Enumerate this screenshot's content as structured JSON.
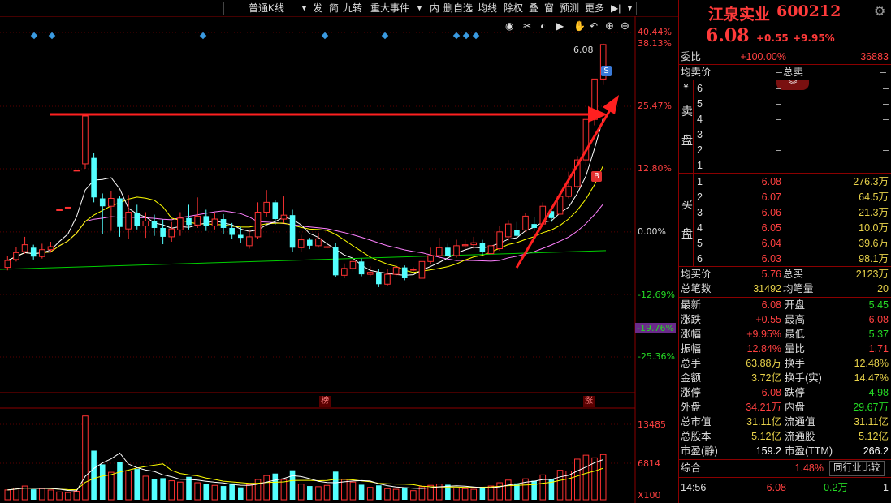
{
  "toolbar": {
    "period": "普通K线",
    "items": [
      "发",
      "简",
      "九转",
      "重大事件",
      "内",
      "删自选",
      "均线",
      "除权",
      "叠",
      "窗",
      "预测",
      "更多"
    ]
  },
  "axis": {
    "pct_labels": [
      "40.44%",
      "38.13%",
      "25.47%",
      "12.80%",
      "0.00%",
      "-12.69%",
      "-19.76%",
      "-25.36%"
    ],
    "vol_labels": [
      "13485",
      "6814",
      "X100"
    ],
    "price_marker": "6.08",
    "markers": {
      "bang": "榜",
      "zhang": "涨",
      "s": "S",
      "b": "B"
    }
  },
  "stock": {
    "name": "江泉实业",
    "code": "600212",
    "price": "6.08",
    "change": "+0.55",
    "pct": "+9.95%"
  },
  "weibi": {
    "label": "委比",
    "pct": "+100.00%",
    "value": "36883"
  },
  "sell_header": {
    "label": "均卖价",
    "value": "–",
    "label2": "总卖",
    "value2": "–"
  },
  "sell_side": {
    "title": "卖盘",
    "prefix": "¥",
    "levels": [
      {
        "n": "6",
        "p": "–",
        "v": "–"
      },
      {
        "n": "5",
        "p": "–",
        "v": "–"
      },
      {
        "n": "4",
        "p": "–",
        "v": "–"
      },
      {
        "n": "3",
        "p": "–",
        "v": "–"
      },
      {
        "n": "2",
        "p": "–",
        "v": "–"
      },
      {
        "n": "1",
        "p": "–",
        "v": "–"
      }
    ]
  },
  "buy_side": {
    "title": "买盘",
    "levels": [
      {
        "n": "1",
        "p": "6.08",
        "v": "276.3万"
      },
      {
        "n": "2",
        "p": "6.07",
        "v": "64.5万"
      },
      {
        "n": "3",
        "p": "6.06",
        "v": "21.3万"
      },
      {
        "n": "4",
        "p": "6.05",
        "v": "10.0万"
      },
      {
        "n": "5",
        "p": "6.04",
        "v": "39.6万"
      },
      {
        "n": "6",
        "p": "6.03",
        "v": "98.1万"
      }
    ]
  },
  "avg_buy": {
    "label": "均买价",
    "value": "5.76",
    "label2": "总买",
    "value2": "2123万"
  },
  "trade_count": {
    "label": "总笔数",
    "value": "31492",
    "label2": "均笔量",
    "value2": "20"
  },
  "stats": [
    {
      "l1": "最新",
      "v1": "6.08",
      "c1": "red",
      "l2": "开盘",
      "v2": "5.45",
      "c2": "green"
    },
    {
      "l1": "涨跌",
      "v1": "+0.55",
      "c1": "red",
      "l2": "最高",
      "v2": "6.08",
      "c2": "red"
    },
    {
      "l1": "涨幅",
      "v1": "+9.95%",
      "c1": "red",
      "l2": "最低",
      "v2": "5.37",
      "c2": "green"
    },
    {
      "l1": "振幅",
      "v1": "12.84%",
      "c1": "red",
      "l2": "量比",
      "v2": "1.71",
      "c2": "red"
    },
    {
      "l1": "总手",
      "v1": "63.88万",
      "c1": "yellow",
      "l2": "换手",
      "v2": "12.48%",
      "c2": "yellow"
    },
    {
      "l1": "金额",
      "v1": "3.72亿",
      "c1": "yellow",
      "l2": "换手(实)",
      "v2": "14.47%",
      "c2": "yellow"
    },
    {
      "l1": "涨停",
      "v1": "6.08",
      "c1": "red",
      "l2": "跌停",
      "v2": "4.98",
      "c2": "green"
    },
    {
      "l1": "外盘",
      "v1": "34.21万",
      "c1": "red",
      "l2": "内盘",
      "v2": "29.67万",
      "c2": "green"
    },
    {
      "l1": "总市值",
      "v1": "31.11亿",
      "c1": "yellow",
      "l2": "流通值",
      "v2": "31.11亿",
      "c2": "yellow"
    },
    {
      "l1": "总股本",
      "v1": "5.12亿",
      "c1": "yellow",
      "l2": "流通股",
      "v2": "5.12亿",
      "c2": "yellow"
    },
    {
      "l1": "市盈(静)",
      "v1": "159.2",
      "c1": "white",
      "l2": "市盈(TTM)",
      "v2": "266.2",
      "c2": "white"
    }
  ],
  "composite": {
    "label": "综合",
    "pct": "1.48%",
    "compare_btn": "同行业比较"
  },
  "tick": {
    "time": "14:56",
    "price": "6.08",
    "vol": "0.2万",
    "n": "1"
  },
  "colors": {
    "up": "#ff3232",
    "down": "#54ffff",
    "ma5": "#ffffff",
    "ma10": "#ffff00",
    "ma20": "#ff80ff",
    "ma60": "#00d000",
    "border": "#8b0000"
  },
  "chart_data": {
    "type": "candlestick",
    "pct_axis": {
      "top": 40.44,
      "bottom": -25.36
    },
    "volume_axis_labels": [
      13485,
      6814
    ],
    "candles": [
      {
        "o": -7.2,
        "c": -5.8,
        "h": -4.8,
        "l": -7.8,
        "v": 1500
      },
      {
        "o": -5.6,
        "c": -4.2,
        "h": -3.0,
        "l": -6.0,
        "v": 1800
      },
      {
        "o": -4.0,
        "c": -2.6,
        "h": -1.0,
        "l": -4.4,
        "v": 2100
      },
      {
        "o": -3.2,
        "c": -5.0,
        "h": -2.6,
        "l": -5.6,
        "v": 1600
      },
      {
        "o": -5.0,
        "c": -3.6,
        "h": -2.4,
        "l": -5.4,
        "v": 1700
      },
      {
        "o": -3.6,
        "c": -3.0,
        "h": -2.0,
        "l": -4.2,
        "v": 1500
      },
      {
        "o": 4.5,
        "c": 4.5,
        "h": 4.5,
        "l": 4.5,
        "v": 1200
      },
      {
        "o": 5.0,
        "c": 5.0,
        "h": 5.0,
        "l": 5.0,
        "v": 1100
      },
      {
        "o": 12.5,
        "c": 12.5,
        "h": 12.5,
        "l": 12.5,
        "v": 1300
      },
      {
        "o": 13.8,
        "c": 23.5,
        "h": 23.5,
        "l": 12.8,
        "v": 12800
      },
      {
        "o": 15.0,
        "c": 7.0,
        "h": 16.0,
        "l": 6.0,
        "v": 7500
      },
      {
        "o": 6.8,
        "c": 5.2,
        "h": 7.8,
        "l": -0.5,
        "v": 5400
      },
      {
        "o": 5.2,
        "c": 6.8,
        "h": 8.2,
        "l": 0.2,
        "v": 4200
      },
      {
        "o": 6.8,
        "c": 1.0,
        "h": 7.2,
        "l": -1.0,
        "v": 5800
      },
      {
        "o": 0.6,
        "c": 4.0,
        "h": 7.5,
        "l": -1.5,
        "v": 4400
      },
      {
        "o": 3.8,
        "c": 1.2,
        "h": 5.5,
        "l": 0.5,
        "v": 4700
      },
      {
        "o": 1.2,
        "c": 2.2,
        "h": 4.0,
        "l": -1.2,
        "v": 3600
      },
      {
        "o": 2.2,
        "c": 0.8,
        "h": 3.5,
        "l": -0.8,
        "v": 3100
      },
      {
        "o": 0.8,
        "c": -1.0,
        "h": 2.5,
        "l": -2.5,
        "v": 3300
      },
      {
        "o": -1.0,
        "c": 0.6,
        "h": 2.0,
        "l": -2.0,
        "v": 2900
      },
      {
        "o": 0.4,
        "c": 2.8,
        "h": 4.0,
        "l": -0.8,
        "v": 2700
      },
      {
        "o": 2.8,
        "c": 1.4,
        "h": 5.5,
        "l": 0.5,
        "v": 3500
      },
      {
        "o": 1.4,
        "c": 3.2,
        "h": 7.0,
        "l": 0.8,
        "v": 2600
      },
      {
        "o": 3.2,
        "c": 1.2,
        "h": 4.5,
        "l": 0.2,
        "v": 2400
      },
      {
        "o": 1.2,
        "c": 2.6,
        "h": 3.8,
        "l": 0.5,
        "v": 2200
      },
      {
        "o": 2.6,
        "c": 0.8,
        "h": 3.6,
        "l": -0.5,
        "v": 2100
      },
      {
        "o": 0.8,
        "c": -0.6,
        "h": 1.8,
        "l": -1.5,
        "v": 2500
      },
      {
        "o": -0.6,
        "c": -1.2,
        "h": 1.0,
        "l": -2.2,
        "v": 1900
      },
      {
        "o": -2.8,
        "c": -1.0,
        "h": 0.5,
        "l": -3.4,
        "v": 2300
      },
      {
        "o": -1.0,
        "c": 4.0,
        "h": 6.0,
        "l": -1.5,
        "v": 3100
      },
      {
        "o": 4.0,
        "c": 6.0,
        "h": 8.5,
        "l": 3.0,
        "v": 3700
      },
      {
        "o": 6.0,
        "c": 2.6,
        "h": 6.5,
        "l": 1.5,
        "v": 4000
      },
      {
        "o": 2.6,
        "c": 3.4,
        "h": 7.2,
        "l": 1.8,
        "v": 3100
      },
      {
        "o": 3.4,
        "c": -3.2,
        "h": 4.5,
        "l": -4.0,
        "v": 4500
      },
      {
        "o": -3.2,
        "c": -1.6,
        "h": -0.6,
        "l": -4.0,
        "v": 2400
      },
      {
        "o": -1.6,
        "c": -2.8,
        "h": -1.2,
        "l": -3.5,
        "v": 2100
      },
      {
        "o": -2.8,
        "c": -1.4,
        "h": -0.2,
        "l": -3.2,
        "v": 2000
      },
      {
        "o": -3.0,
        "c": -3.0,
        "h": -2.6,
        "l": -3.4,
        "v": 2200
      },
      {
        "o": -3.0,
        "c": -8.8,
        "h": -2.2,
        "l": -9.2,
        "v": 4300
      },
      {
        "o": -8.8,
        "c": -7.4,
        "h": -6.4,
        "l": -9.4,
        "v": 3100
      },
      {
        "o": -7.4,
        "c": -6.0,
        "h": -5.0,
        "l": -8.0,
        "v": 2700
      },
      {
        "o": -6.0,
        "c": -8.6,
        "h": -5.4,
        "l": -9.0,
        "v": 2300
      },
      {
        "o": -8.6,
        "c": -8.2,
        "h": -7.0,
        "l": -9.0,
        "v": 1900
      },
      {
        "o": -8.2,
        "c": -10.6,
        "h": -7.6,
        "l": -11.2,
        "v": 2200
      },
      {
        "o": -10.6,
        "c": -8.6,
        "h": -7.6,
        "l": -11.0,
        "v": 1700
      },
      {
        "o": -8.6,
        "c": -7.2,
        "h": -6.4,
        "l": -9.0,
        "v": 1600
      },
      {
        "o": -7.2,
        "c": -9.4,
        "h": -6.8,
        "l": -9.8,
        "v": 1900
      },
      {
        "o": -7.6,
        "c": -7.6,
        "h": -7.2,
        "l": -8.0,
        "v": 1400
      },
      {
        "o": -9.4,
        "c": -6.0,
        "h": -5.2,
        "l": -9.8,
        "v": 2000
      },
      {
        "o": -6.0,
        "c": -4.8,
        "h": -3.2,
        "l": -6.6,
        "v": 2200
      },
      {
        "o": -4.8,
        "c": -3.2,
        "h": -1.2,
        "l": -5.4,
        "v": 2400
      },
      {
        "o": -3.2,
        "c": -4.8,
        "h": -2.4,
        "l": -5.4,
        "v": 2300
      },
      {
        "o": -4.8,
        "c": -2.8,
        "h": -1.6,
        "l": -5.2,
        "v": 1800
      },
      {
        "o": -2.8,
        "c": -2.6,
        "h": -1.6,
        "l": -3.6,
        "v": 1700
      },
      {
        "o": -2.6,
        "c": -2.2,
        "h": -1.0,
        "l": -3.4,
        "v": 1600
      },
      {
        "o": -2.2,
        "c": -4.0,
        "h": -1.6,
        "l": -4.6,
        "v": 1900
      },
      {
        "o": -4.4,
        "c": -2.8,
        "h": -1.8,
        "l": -5.0,
        "v": 2100
      },
      {
        "o": -3.4,
        "c": 0.0,
        "h": 1.2,
        "l": -3.8,
        "v": 2600
      },
      {
        "o": -1.0,
        "c": 1.6,
        "h": 2.4,
        "l": -1.8,
        "v": 3000
      },
      {
        "o": 0.4,
        "c": -0.8,
        "h": 2.0,
        "l": -1.4,
        "v": 2500
      },
      {
        "o": 0.4,
        "c": 3.2,
        "h": 3.8,
        "l": 0.0,
        "v": 3200
      },
      {
        "o": 1.6,
        "c": 0.8,
        "h": 3.0,
        "l": 0.2,
        "v": 2900
      },
      {
        "o": 1.6,
        "c": 5.2,
        "h": 6.0,
        "l": 1.0,
        "v": 3800
      },
      {
        "o": 4.2,
        "c": 2.8,
        "h": 5.2,
        "l": 2.0,
        "v": 3100
      },
      {
        "o": 3.6,
        "c": 7.2,
        "h": 8.8,
        "l": 3.0,
        "v": 4500
      },
      {
        "o": 7.2,
        "c": 9.2,
        "h": 12.2,
        "l": 6.8,
        "v": 4400
      },
      {
        "o": 9.2,
        "c": 14.6,
        "h": 15.4,
        "l": 8.8,
        "v": 6200
      },
      {
        "o": 14.6,
        "c": 22.8,
        "h": 22.8,
        "l": 13.6,
        "v": 6800
      },
      {
        "o": 22.8,
        "c": 31.0,
        "h": 31.0,
        "l": 21.6,
        "v": 6400
      },
      {
        "o": 31.0,
        "c": 38.0,
        "h": 38.2,
        "l": 29.8,
        "v": 6900
      }
    ]
  }
}
